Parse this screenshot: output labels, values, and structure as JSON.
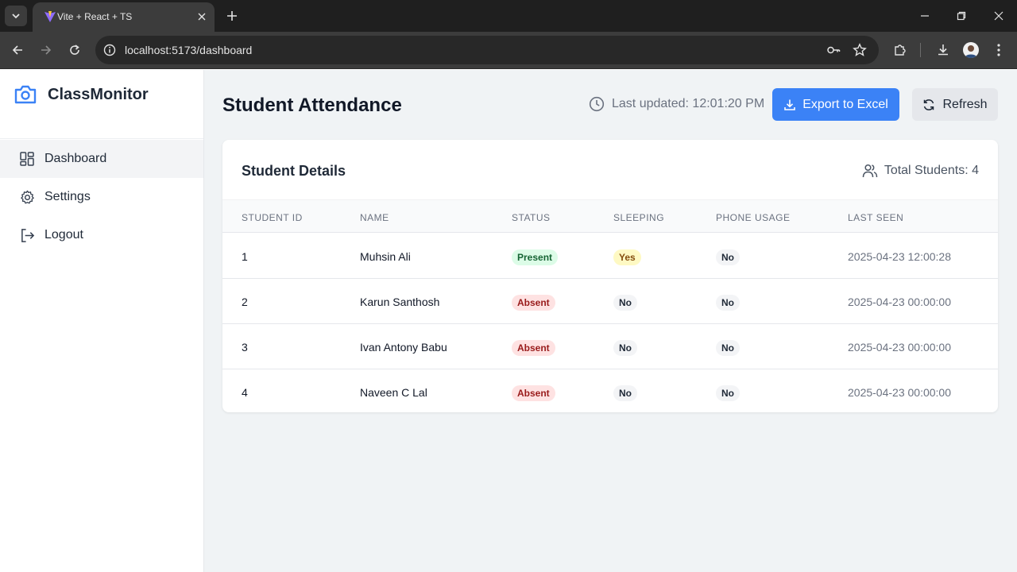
{
  "browser": {
    "tab_title": "Vite + React + TS",
    "url": "localhost:5173/dashboard"
  },
  "sidebar": {
    "brand": "ClassMonitor",
    "items": [
      {
        "label": "Dashboard",
        "icon": "layout-grid-icon",
        "active": true
      },
      {
        "label": "Settings",
        "icon": "gear-icon",
        "active": false
      },
      {
        "label": "Logout",
        "icon": "logout-icon",
        "active": false
      }
    ]
  },
  "header": {
    "title": "Student Attendance",
    "last_updated": "Last updated: 12:01:20 PM",
    "export_label": "Export to Excel",
    "refresh_label": "Refresh"
  },
  "card": {
    "title": "Student Details",
    "total": "Total Students: 4",
    "columns": [
      "Student ID",
      "Name",
      "Status",
      "Sleeping",
      "Phone Usage",
      "Last Seen"
    ],
    "rows": [
      {
        "id": "1",
        "name": "Muhsin Ali",
        "status": "Present",
        "sleeping": "Yes",
        "phone": "No",
        "last_seen": "2025-04-23 12:00:28"
      },
      {
        "id": "2",
        "name": "Karun Santhosh",
        "status": "Absent",
        "sleeping": "No",
        "phone": "No",
        "last_seen": "2025-04-23 00:00:00"
      },
      {
        "id": "3",
        "name": "Ivan Antony Babu",
        "status": "Absent",
        "sleeping": "No",
        "phone": "No",
        "last_seen": "2025-04-23 00:00:00"
      },
      {
        "id": "4",
        "name": "Naveen C Lal",
        "status": "Absent",
        "sleeping": "No",
        "phone": "No",
        "last_seen": "2025-04-23 00:00:00"
      }
    ]
  },
  "colors": {
    "accent": "#3b82f6",
    "present_bg": "#dcfce7",
    "absent_bg": "#fee2e2",
    "yes_bg": "#fef9c3"
  }
}
